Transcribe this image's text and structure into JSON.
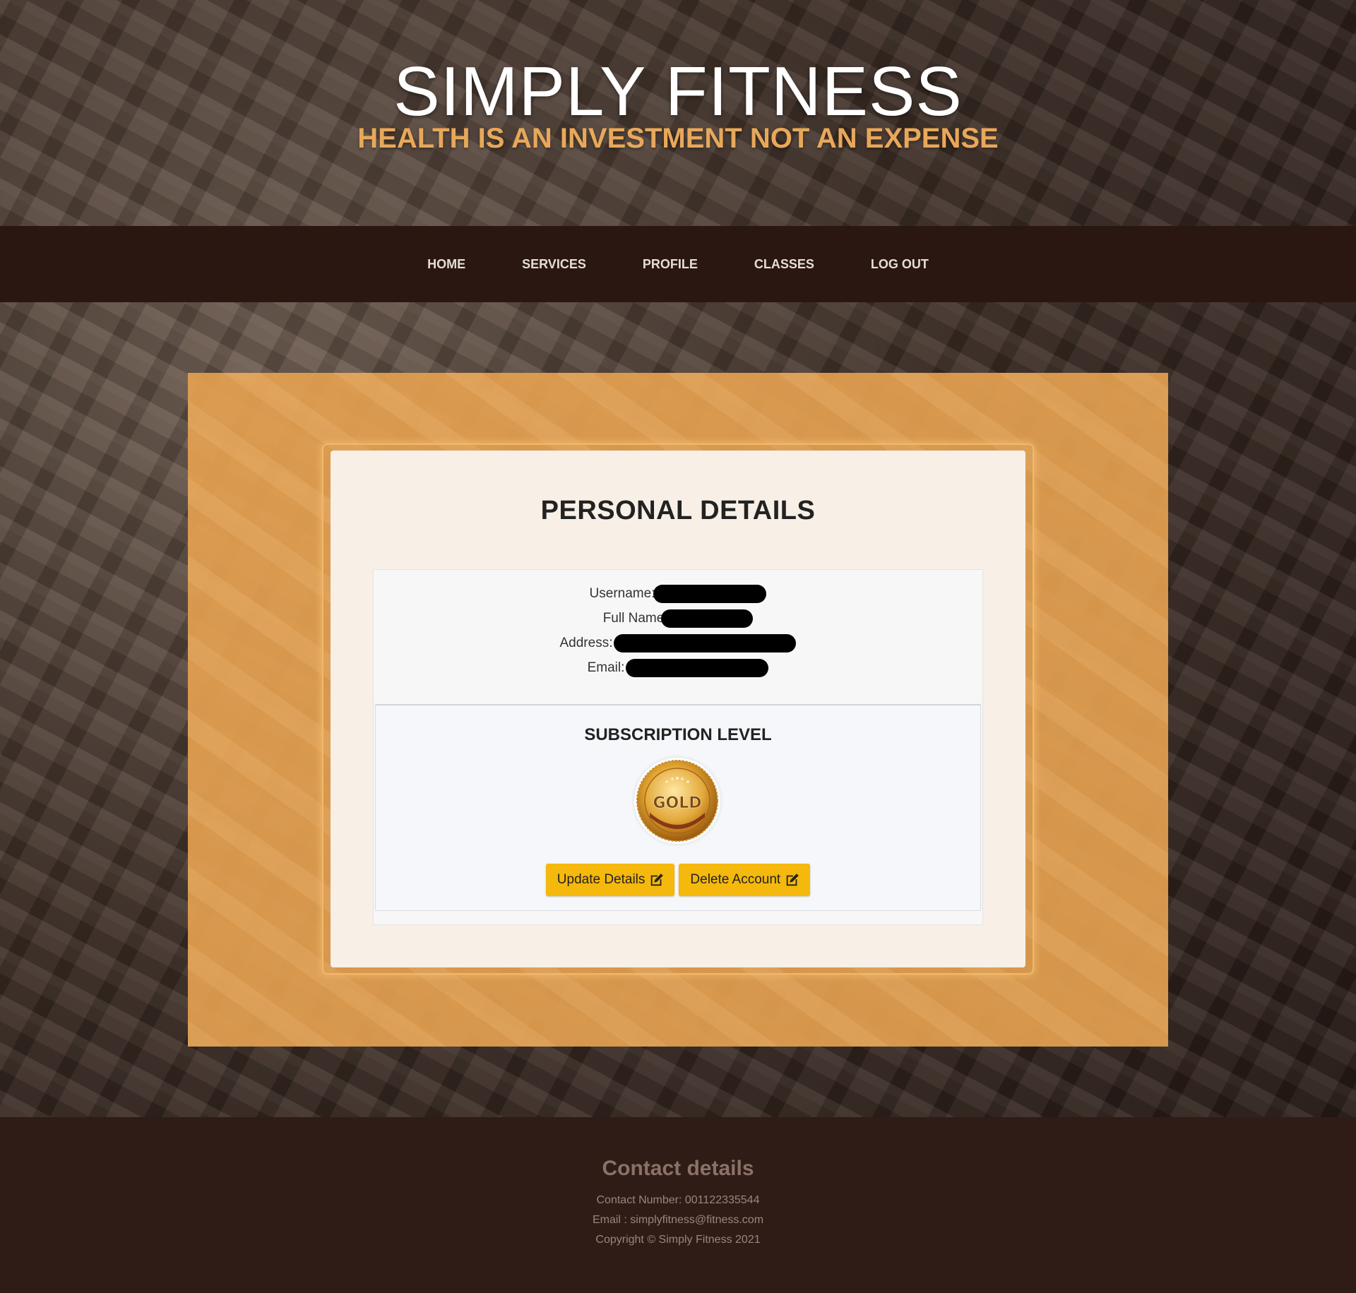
{
  "header": {
    "title": "SIMPLY FITNESS",
    "tagline": "HEALTH IS AN INVESTMENT NOT AN EXPENSE"
  },
  "nav": {
    "items": [
      {
        "label": "HOME"
      },
      {
        "label": "SERVICES"
      },
      {
        "label": "PROFILE"
      },
      {
        "label": "CLASSES"
      },
      {
        "label": "LOG OUT"
      }
    ]
  },
  "profile": {
    "title": "PERSONAL DETAILS",
    "fields": [
      {
        "label": "Username:"
      },
      {
        "label": "Full Name"
      },
      {
        "label": "Address:"
      },
      {
        "label": "Email:"
      }
    ],
    "subscription": {
      "title": "SUBSCRIPTION LEVEL",
      "level": "GOLD"
    },
    "buttons": {
      "update": "Update Details",
      "delete": "Delete Account"
    }
  },
  "footer": {
    "title": "Contact details",
    "contact_number": "Contact Number: 001122335544",
    "email": "Email : simplyfitness@fitness.com",
    "copyright": "Copyright © Simply Fitness 2021"
  },
  "colors": {
    "accent": "#e8a85a",
    "nav_bg": "#2a1712",
    "panel": "#e8a452",
    "button": "#f5b80c"
  },
  "icons": {
    "edit": "edit-icon",
    "badge": "gold-medal-icon"
  }
}
